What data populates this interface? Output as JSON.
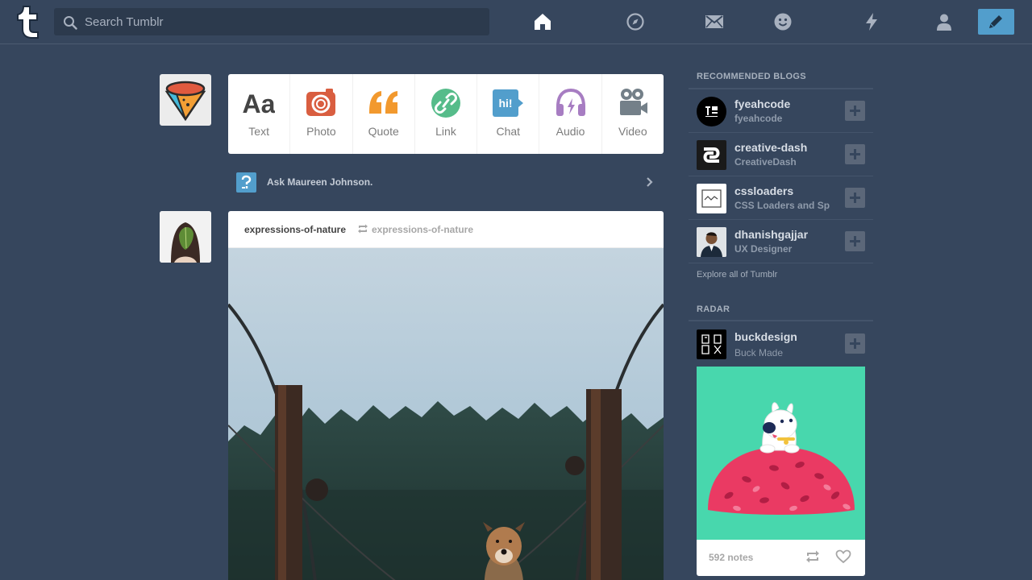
{
  "search": {
    "placeholder": "Search Tumblr"
  },
  "nav": {
    "icons": [
      "home-icon",
      "explore-compass-icon",
      "inbox-mail-icon",
      "messaging-face-icon",
      "activity-lightning-icon",
      "account-person-icon",
      "compose-pencil-icon"
    ]
  },
  "post_types": [
    {
      "label": "Text",
      "icon": "text-aa-icon",
      "color": "#444444"
    },
    {
      "label": "Photo",
      "icon": "camera-icon",
      "color": "#d95e40"
    },
    {
      "label": "Quote",
      "icon": "quote-icon",
      "color": "#f2992e"
    },
    {
      "label": "Link",
      "icon": "link-icon",
      "color": "#56bc8a"
    },
    {
      "label": "Chat",
      "icon": "chat-bubble-icon",
      "color": "#529ecc"
    },
    {
      "label": "Audio",
      "icon": "headphones-icon",
      "color": "#a77dc2"
    },
    {
      "label": "Video",
      "icon": "video-camera-icon",
      "color": "#748089"
    }
  ],
  "ask": {
    "text": "Ask Maureen Johnson."
  },
  "post": {
    "author": "expressions-of-nature",
    "source": "expressions-of-nature"
  },
  "sidebar": {
    "recommended_title": "RECOMMENDED BLOGS",
    "blogs": [
      {
        "name": "fyeahcode",
        "subtitle": "fyeahcode"
      },
      {
        "name": "creative-dash",
        "subtitle": "CreativeDash"
      },
      {
        "name": "cssloaders",
        "subtitle": "CSS Loaders and Sp"
      },
      {
        "name": "dhanishgajjar",
        "subtitle": "UX Designer"
      }
    ],
    "explore": "Explore all of Tumblr",
    "radar_title": "RADAR",
    "radar": {
      "name": "buckdesign",
      "subtitle": "Buck Made",
      "notes": "592 notes"
    }
  },
  "colors": {
    "background": "#36465d",
    "accent": "#529ecc",
    "radar_art": "#48d7ad"
  }
}
